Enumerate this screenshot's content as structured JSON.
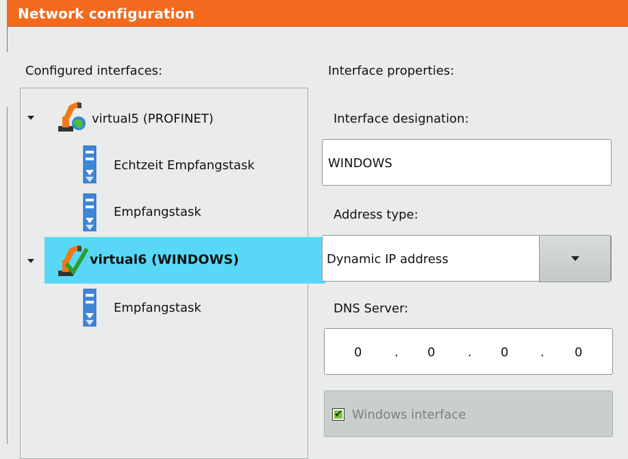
{
  "window": {
    "title": "Network configuration"
  },
  "configured": {
    "label": "Configured interfaces:",
    "items": [
      {
        "label": "virtual5 (PROFINET)",
        "icon": "robot-globe-icon",
        "level": 0,
        "expanded": true,
        "selected": false
      },
      {
        "label": "Echtzeit Empfangstask",
        "icon": "receive-task-icon",
        "level": 1
      },
      {
        "label": "Empfangstask",
        "icon": "receive-task-icon",
        "level": 1
      },
      {
        "label": "virtual6 (WINDOWS)",
        "icon": "robot-check-icon",
        "level": 0,
        "expanded": true,
        "selected": true
      },
      {
        "label": "Empfangstask",
        "icon": "receive-task-icon",
        "level": 1
      }
    ]
  },
  "properties": {
    "label": "Interface properties:",
    "designation_label": "Interface designation:",
    "designation_value": "WINDOWS",
    "address_type_label": "Address type:",
    "address_type_value": "Dynamic IP address",
    "dns_label": "DNS Server:",
    "dns": [
      "0",
      "0",
      "0",
      "0"
    ],
    "dns_separator": ".",
    "windows_interface_label": "Windows interface",
    "windows_interface_checked": true
  },
  "colors": {
    "title_bar": "#f26a1e",
    "selection": "#58d8f6",
    "checkbox_fill": "#7ec23b"
  }
}
